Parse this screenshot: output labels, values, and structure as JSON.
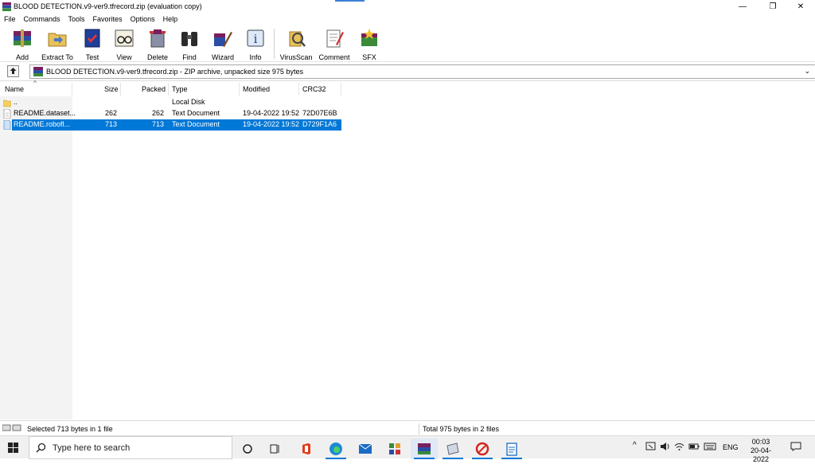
{
  "window": {
    "title": "BLOOD DETECTION.v9-ver9.tfrecord.zip (evaluation copy)",
    "min_glyph": "—",
    "max_glyph": "❐",
    "close_glyph": "✕"
  },
  "menu": [
    "File",
    "Commands",
    "Tools",
    "Favorites",
    "Options",
    "Help"
  ],
  "toolbar": {
    "buttons": [
      {
        "label": "Add",
        "icon": "add-archive-icon"
      },
      {
        "label": "Extract To",
        "icon": "extract-folder-icon"
      },
      {
        "label": "Test",
        "icon": "test-book-icon"
      },
      {
        "label": "View",
        "icon": "view-glasses-icon"
      },
      {
        "label": "Delete",
        "icon": "delete-icon"
      },
      {
        "label": "Find",
        "icon": "binoculars-icon"
      },
      {
        "label": "Wizard",
        "icon": "wizard-icon"
      },
      {
        "label": "Info",
        "icon": "info-icon"
      },
      {
        "label": "VirusScan",
        "icon": "virusscan-icon"
      },
      {
        "label": "Comment",
        "icon": "comment-icon"
      },
      {
        "label": "SFX",
        "icon": "sfx-icon"
      }
    ]
  },
  "address": {
    "path": "BLOOD DETECTION.v9-ver9.tfrecord.zip - ZIP archive, unpacked size 975 bytes",
    "dropdown_glyph": "⌄"
  },
  "columns": {
    "name": "Name",
    "size": "Size",
    "packed": "Packed",
    "type": "Type",
    "modified": "Modified",
    "crc": "CRC32",
    "sort_glyph": "^"
  },
  "files": [
    {
      "name": "..",
      "size": "",
      "packed": "",
      "type": "Local Disk",
      "modified": "",
      "crc": "",
      "icon": "folder-icon",
      "selected": false
    },
    {
      "name": "README.dataset...",
      "size": "262",
      "packed": "262",
      "type": "Text Document",
      "modified": "19-04-2022 19:52",
      "crc": "72D07E6B",
      "icon": "text-file-icon",
      "selected": false
    },
    {
      "name": "README.robofl...",
      "size": "713",
      "packed": "713",
      "type": "Text Document",
      "modified": "19-04-2022 19:52",
      "crc": "D729F1A6",
      "icon": "text-file-icon",
      "selected": true
    }
  ],
  "status": {
    "selected": "Selected 713 bytes in 1 file",
    "total": "Total 975 bytes in 2 files"
  },
  "taskbar": {
    "search_placeholder": "Type here to search",
    "apps": [
      "task-view-circle-icon",
      "widgets-icon",
      "office-icon",
      "edge-icon",
      "mail-icon",
      "app-icon",
      "winrar-icon",
      "file-icon",
      "acrobat-icon",
      "notepad-icon"
    ],
    "language": "ENG",
    "time": "00:03",
    "date": "20-04-2022"
  },
  "colors": {
    "selection": "#0078d7",
    "accent": "#3c7fd6"
  }
}
